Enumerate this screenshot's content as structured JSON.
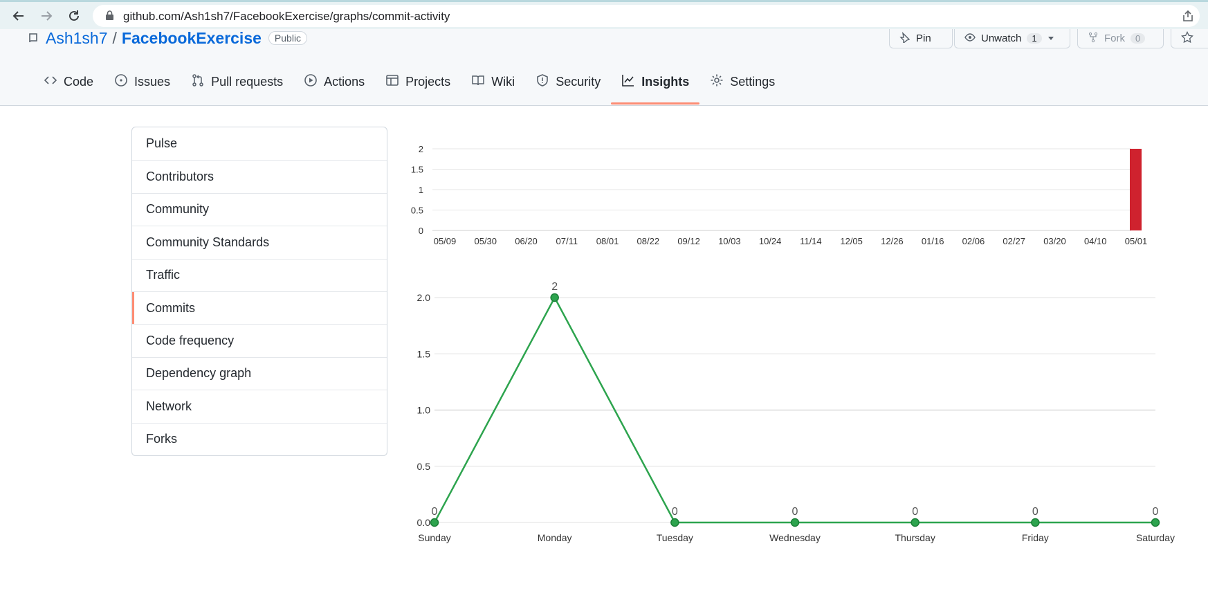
{
  "browser": {
    "url": "github.com/Ash1sh7/FacebookExercise/graphs/commit-activity"
  },
  "repo": {
    "owner": "Ash1sh7",
    "separator": "/",
    "name": "FacebookExercise",
    "visibility": "Public",
    "pin_label": "Pin",
    "unwatch_label": "Unwatch",
    "unwatch_count": "1",
    "fork_label": "Fork",
    "fork_count": "0"
  },
  "tabs": [
    {
      "label": "Code",
      "icon": "code-icon"
    },
    {
      "label": "Issues",
      "icon": "issue-icon"
    },
    {
      "label": "Pull requests",
      "icon": "pull-request-icon"
    },
    {
      "label": "Actions",
      "icon": "play-icon"
    },
    {
      "label": "Projects",
      "icon": "table-icon"
    },
    {
      "label": "Wiki",
      "icon": "book-icon"
    },
    {
      "label": "Security",
      "icon": "shield-icon"
    },
    {
      "label": "Insights",
      "icon": "graph-icon",
      "active": true
    },
    {
      "label": "Settings",
      "icon": "gear-icon"
    }
  ],
  "menu": {
    "items": [
      "Pulse",
      "Contributors",
      "Community",
      "Community Standards",
      "Traffic",
      "Commits",
      "Code frequency",
      "Dependency graph",
      "Network",
      "Forks"
    ],
    "selected": "Commits"
  },
  "colors": {
    "bar": "#cf222e",
    "line": "#2da44e",
    "accent": "#fd8c73",
    "link": "#0969da"
  },
  "chart_data": [
    {
      "type": "bar",
      "categories": [
        "05/09",
        "05/30",
        "06/20",
        "07/11",
        "08/01",
        "08/22",
        "09/12",
        "10/03",
        "10/24",
        "11/14",
        "12/05",
        "12/26",
        "01/16",
        "02/06",
        "02/27",
        "03/20",
        "04/10",
        "05/01"
      ],
      "values": [
        0,
        0,
        0,
        0,
        0,
        0,
        0,
        0,
        0,
        0,
        0,
        0,
        0,
        0,
        0,
        0,
        0,
        2
      ],
      "y_ticks": [
        "0",
        "0.5",
        "1",
        "1.5",
        "2"
      ],
      "ylim": [
        0,
        2
      ],
      "grid": true
    },
    {
      "type": "line",
      "categories": [
        "Sunday",
        "Monday",
        "Tuesday",
        "Wednesday",
        "Thursday",
        "Friday",
        "Saturday"
      ],
      "values": [
        0,
        2,
        0,
        0,
        0,
        0,
        0
      ],
      "y_ticks": [
        "0.0",
        "0.5",
        "1.0",
        "1.5",
        "2.0"
      ],
      "ylim": [
        0,
        2
      ],
      "grid": true,
      "data_labels": true
    }
  ]
}
